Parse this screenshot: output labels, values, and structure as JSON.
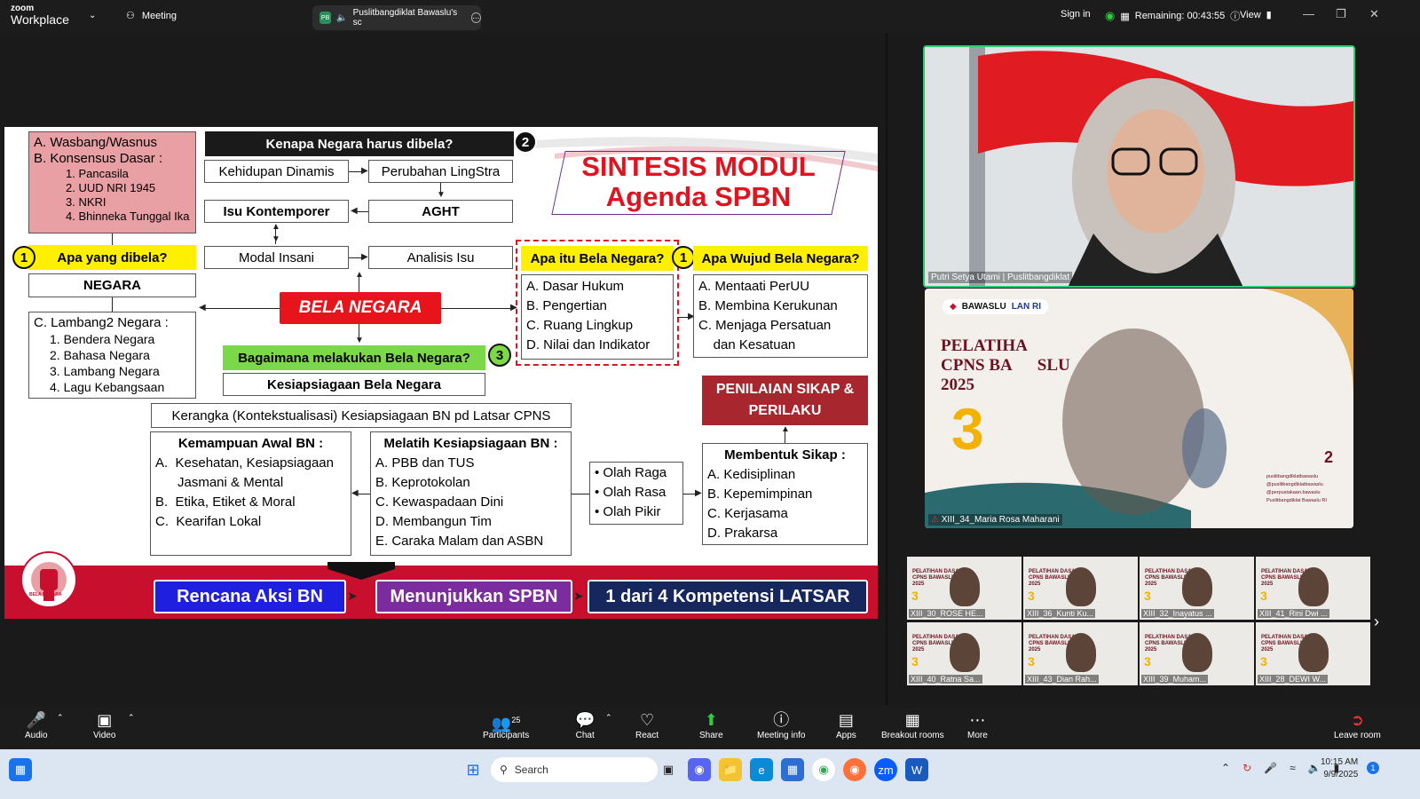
{
  "app": {
    "brand_top": "zoom",
    "brand_bottom": "Workplace",
    "meeting_tab": "Meeting",
    "share_tab": "Puslitbangdiklat Bawaslu's sc",
    "share_badge": "PB"
  },
  "topright": {
    "sign_in": "Sign in",
    "remaining": "Remaining: 00:43:55",
    "view": "View"
  },
  "slide": {
    "wasbang": "A. Wasbang/Wasnus",
    "konsensus": "B. Konsensus Dasar :",
    "konsensus_items": [
      "1.  Pancasila",
      "2.  UUD NRI 1945",
      "3.  NKRI",
      "4.  Bhinneka Tunggal Ika"
    ],
    "q_negara": "Kenapa Negara harus dibela?",
    "n2": "2",
    "n1a": "1",
    "n1b": "1",
    "n3": "3",
    "kehidupan": "Kehidupan Dinamis",
    "perubahan": "Perubahan LingStra",
    "isu": "Isu Kontemporer",
    "aght": "AGHT",
    "modal": "Modal Insani",
    "analisis": "Analisis Isu",
    "sintesis1": "SINTESIS MODUL",
    "sintesis2": "Agenda SPBN",
    "apa_dibela": "Apa yang dibela?",
    "negara": "NEGARA",
    "lambang_title": "C. Lambang2 Negara :",
    "lambang_items": [
      "1.  Bendera Negara",
      "2.  Bahasa Negara",
      "3.  Lambang Negara",
      "4.  Lagu Kebangsaan"
    ],
    "bela": "BELA NEGARA",
    "apa_itu": "Apa itu Bela Negara?",
    "apa_itu_items": [
      "A. Dasar Hukum",
      "B. Pengertian",
      "C. Ruang Lingkup",
      "D. Nilai dan Indikator"
    ],
    "wujud": "Apa Wujud Bela Negara?",
    "wujud_items": [
      "A. Mentaati PerUU",
      "B. Membina Kerukunan",
      "C. Menjaga Persatuan",
      "    dan Kesatuan"
    ],
    "bagaimana": "Bagaimana melakukan Bela Negara?",
    "kesiapsiagaan": "Kesiapsiagaan Bela Negara",
    "kerangka": "Kerangka (Kontekstualisasi) Kesiapsiagaan BN pd Latsar CPNS",
    "penilaian": "PENILAIAN SIKAP & PERILAKU",
    "kemampuan_title": "Kemampuan Awal BN :",
    "kemampuan_items": [
      "A.  Kesehatan, Kesiapsiagaan",
      "      Jasmani & Mental",
      "B.  Etika, Etiket & Moral",
      "C.  Kearifan Lokal"
    ],
    "melatih_title": "Melatih Kesiapsiagaan BN :",
    "melatih_items": [
      "A. PBB dan TUS",
      "B. Keprotokolan",
      "C. Kewaspadaan Dini",
      "D. Membangun Tim",
      "E. Caraka Malam dan ASBN"
    ],
    "olah_items": [
      "• Olah Raga",
      "• Olah Rasa",
      "• Olah Pikir"
    ],
    "membentuk_title": "Membentuk Sikap :",
    "membentuk_items": [
      "A. Kedisiplinan",
      "B. Kepemimpinan",
      "C. Kerjasama",
      "D. Prakarsa"
    ],
    "rencana": "Rencana Aksi BN",
    "menunjukkan": "Menunjukkan SPBN",
    "kompetensi": "1 dari 4 Kompetensi LATSAR",
    "logo_text": "BELA NEGARA"
  },
  "videos": {
    "main1_label": "Putri Setya Utami | Puslitbangdiklat",
    "main2_label": "XIII_34_Maria Rosa Maharani",
    "banner_lines": [
      "PELATIHA",
      "CPNS BA",
      "SLU",
      "2025"
    ],
    "banner_brand": "BAWASLU",
    "banner_partner": "LAN RI",
    "banner_num": "3",
    "banner_year": "2",
    "socials": [
      "puslitbangdiklatbawaslu",
      "@puslitbangdiklatbawaslu",
      "@perpustakaan.bawaslu",
      "Puslitbangdiklat Bawaslu RI"
    ],
    "thumb_title": [
      "PELATIHAN DASAR",
      "CPNS BAWASLU",
      "2025"
    ],
    "thumb_num": "3",
    "thumbs": [
      "XIII_30_ROSE HE...",
      "XIII_36_Kunti Ku...",
      "XIII_32_Inayatus ...",
      "XIII_41_Rini Dwi ...",
      "XIII_40_Ratna Sa...",
      "XIII_43_Dian Rah...",
      "XIII_39_Muham...",
      "XIII_28_DEWI W..."
    ]
  },
  "toolbar": {
    "audio": "Audio",
    "video": "Video",
    "participants": "Participants",
    "participants_count": "25",
    "chat": "Chat",
    "react": "React",
    "share": "Share",
    "meeting_info": "Meeting info",
    "apps": "Apps",
    "breakout": "Breakout rooms",
    "more": "More",
    "leave": "Leave room"
  },
  "taskbar": {
    "search": "Search",
    "time": "10:15 AM",
    "date": "9/9/2025",
    "notif": "1"
  }
}
